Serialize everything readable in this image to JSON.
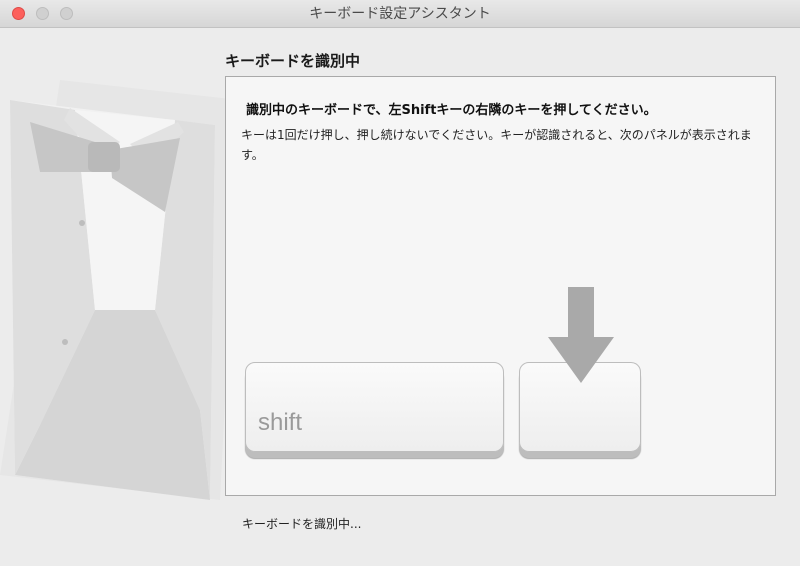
{
  "window": {
    "title": "キーボード設定アシスタント"
  },
  "panel": {
    "heading": "キーボードを識別中",
    "instruction": "識別中のキーボードで、左Shiftキーの右隣のキーを押してください。",
    "description": "キーは1回だけ押し、押し続けないでください。キーが認識されると、次のパネルが表示されます。"
  },
  "keys": {
    "shift_label": "shift"
  },
  "status": {
    "text": "キーボードを識別中..."
  },
  "icons": {
    "close": "close-icon",
    "minimize": "minimize-icon",
    "zoom": "zoom-icon",
    "arrow": "arrow-down-icon",
    "illustration": "tuxedo-illustration"
  },
  "colors": {
    "close_button": "#fc605c",
    "window_background": "#ececec",
    "panel_background": "#f6f6f6"
  }
}
